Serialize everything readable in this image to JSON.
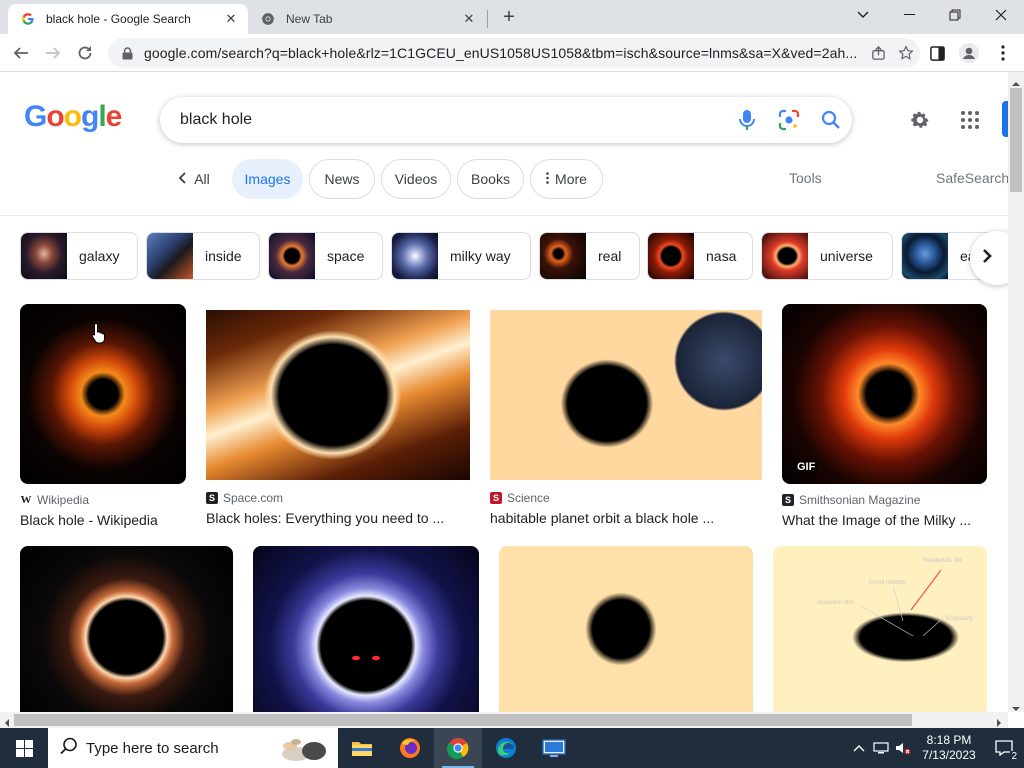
{
  "browser": {
    "tabs": [
      {
        "title": "black hole - Google Search",
        "favicon": "google-g-icon"
      },
      {
        "title": "New Tab",
        "favicon": "chrome-icon"
      }
    ],
    "new_tab_symbol": "+",
    "url": "google.com/search?q=black+hole&rlz=1C1GCEU_enUS1058US1058&tbm=isch&source=lnms&sa=X&ved=2ah..."
  },
  "google": {
    "logo_letters": [
      "G",
      "o",
      "o",
      "g",
      "l",
      "e"
    ],
    "query": "black hole",
    "filters": {
      "all": "All",
      "images": "Images",
      "news": "News",
      "videos": "Videos",
      "books": "Books",
      "more": "More",
      "tools": "Tools",
      "safesearch": "SafeSearch"
    },
    "related": [
      "galaxy",
      "inside",
      "space",
      "milky way",
      "real",
      "nasa",
      "universe",
      "ea"
    ],
    "results": [
      {
        "source": "Wikipedia",
        "title": "Black hole - Wikipedia"
      },
      {
        "source": "Space.com",
        "title": "Black holes: Everything you need to ..."
      },
      {
        "source": "Science",
        "title": "habitable planet orbit a black hole ..."
      },
      {
        "source": "Smithsonian Magazine",
        "title": "What the Image of the Milky ...",
        "badge": "GIF"
      }
    ],
    "diagram_labels": [
      "Relativistic Jet",
      "Accretion disc",
      "Event horizon",
      "Singularity"
    ]
  },
  "taskbar": {
    "search_placeholder": "Type here to search",
    "time": "8:18 PM",
    "date": "7/13/2023",
    "notification_count": "2"
  },
  "colors": {
    "google_blue": "#4285F4",
    "google_red": "#EA4335",
    "google_yellow": "#FBBC05",
    "google_green": "#34A853",
    "selected_chip": "#e8f0fe",
    "taskbar": "#1f2d3d"
  }
}
